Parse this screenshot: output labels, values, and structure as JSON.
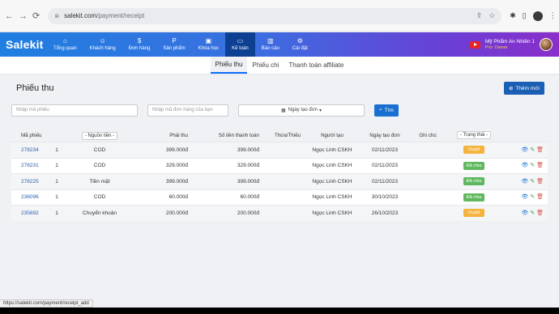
{
  "browser": {
    "url_domain": "salekit.com",
    "url_path": "/payment/receipt"
  },
  "app": {
    "brand": "Salekit",
    "menu": [
      {
        "label": "Tổng quan",
        "icon": "home-icon",
        "glyph": "⌂"
      },
      {
        "label": "Khách hàng",
        "icon": "users-icon",
        "glyph": "👥"
      },
      {
        "label": "Đơn hàng",
        "icon": "dollar-icon",
        "glyph": "$"
      },
      {
        "label": "Sản phẩm",
        "icon": "product-icon",
        "glyph": "P"
      },
      {
        "label": "Khóa học",
        "icon": "course-icon",
        "glyph": "▣"
      },
      {
        "label": "Kế toán",
        "icon": "wallet-icon",
        "glyph": "▭",
        "active": true
      },
      {
        "label": "Báo cáo",
        "icon": "chart-icon",
        "glyph": "▥"
      },
      {
        "label": "Cài đặt",
        "icon": "gear-icon",
        "glyph": "⚙"
      }
    ],
    "user": {
      "name": "Mỹ Phẩm An Nhiên 1",
      "role": "Pro: Owner"
    }
  },
  "subtabs": [
    {
      "label": "Phiếu thu",
      "active": true
    },
    {
      "label": "Phiếu chi"
    },
    {
      "label": "Thanh toán affiliate"
    }
  ],
  "page": {
    "title": "Phiếu thu",
    "add_button": "Thêm mới"
  },
  "filters": {
    "code_placeholder": "Nhập mã phiếu",
    "order_placeholder": "Nhập mã đơn hàng của bạn",
    "date_label": "Ngày tạo đơn",
    "search_label": "Tìm"
  },
  "table": {
    "headers": {
      "code": "Mã phiếu",
      "source": "- Nguồn tiền -",
      "due": "Phải thu",
      "paid": "Số tiền thanh toán",
      "diff": "Thừa/Thiếu",
      "creator": "Người tạo",
      "date": "Ngày tạo đơn",
      "note": "Ghi chú",
      "status": "- Trạng thái -"
    },
    "rows": [
      {
        "code": "278234",
        "qty": "1",
        "source": "COD",
        "due": "399.000đ",
        "paid": "399.000đ",
        "diff": "",
        "creator": "Ngọc Linh CSKH",
        "date": "02/11/2023",
        "note": "",
        "status": "Duyệt",
        "status_color": "orange"
      },
      {
        "code": "278231",
        "qty": "1",
        "source": "COD",
        "due": "329.000đ",
        "paid": "329.000đ",
        "diff": "",
        "creator": "Ngọc Linh CSKH",
        "date": "02/11/2023",
        "note": "",
        "status": "Đã chia",
        "status_color": "green"
      },
      {
        "code": "278225",
        "qty": "1",
        "source": "Tiền mặt",
        "due": "399.000đ",
        "paid": "399.000đ",
        "diff": "",
        "creator": "Ngọc Linh CSKH",
        "date": "02/11/2023",
        "note": "",
        "status": "Đã chia",
        "status_color": "green"
      },
      {
        "code": "236096",
        "qty": "1",
        "source": "COD",
        "due": "60.000đ",
        "paid": "60.000đ",
        "diff": "",
        "creator": "Ngọc Linh CSKH",
        "date": "30/10/2023",
        "note": "",
        "status": "Đã chia",
        "status_color": "green"
      },
      {
        "code": "235692",
        "qty": "1",
        "source": "Chuyển khoản",
        "due": "200.000đ",
        "paid": "200.000đ",
        "diff": "",
        "creator": "Ngọc Linh CSKH",
        "date": "26/10/2023",
        "note": "",
        "status": "Duyệt",
        "status_color": "orange"
      }
    ]
  },
  "statusbar": {
    "url": "https://salekit.com/payment/receipt_add"
  }
}
